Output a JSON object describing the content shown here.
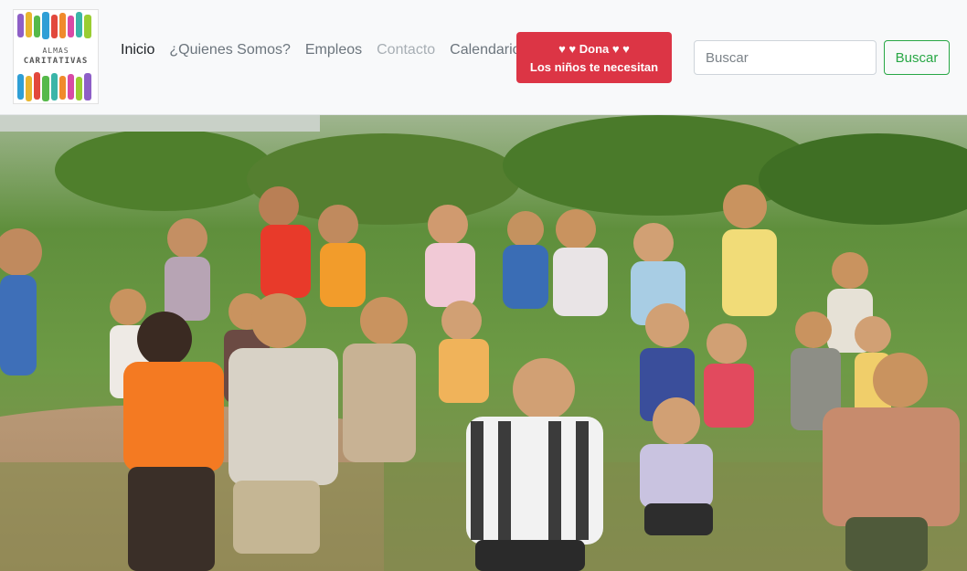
{
  "brand": {
    "logo_line1": "ALMAS",
    "logo_line2": "CARITATIVAS"
  },
  "nav": {
    "items": [
      {
        "label": "Inicio",
        "state": "active"
      },
      {
        "label": "¿Quienes Somos?",
        "state": "normal"
      },
      {
        "label": "Empleos",
        "state": "normal"
      },
      {
        "label": "Contacto",
        "state": "disabled"
      },
      {
        "label": "Calendario",
        "state": "normal"
      }
    ]
  },
  "donate": {
    "line1": "♥ ♥ Dona ♥ ♥",
    "line2": "Los niños te necesitan"
  },
  "search": {
    "placeholder": "Buscar",
    "button_label": "Buscar"
  },
  "hero": {
    "image": "group of cheering children running in a grassy field"
  },
  "colors": {
    "donate_bg": "#dc3545",
    "search_btn": "#28a745",
    "navbar_bg": "#f8f9fa"
  }
}
